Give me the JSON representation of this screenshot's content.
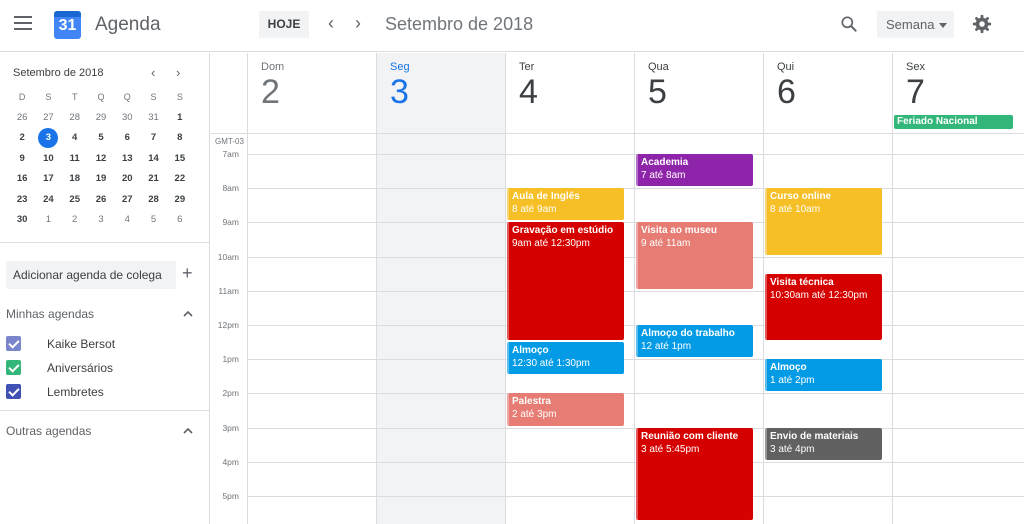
{
  "header": {
    "app_title": "Agenda",
    "logo_day": "31",
    "today_label": "HOJE",
    "month_title": "Setembro de 2018",
    "view_label": "Semana"
  },
  "colors": {
    "accent_blue": "#1a73e8",
    "holiday_green": "#33b679",
    "yellow": "#f6bf26",
    "red": "#d50000",
    "salmon": "#e67c73",
    "purple": "#8e24aa",
    "light_blue": "#039be5",
    "gray": "#616161"
  },
  "mini_calendar": {
    "title": "Setembro de 2018",
    "weekday_headers": [
      "D",
      "S",
      "T",
      "Q",
      "Q",
      "S",
      "S"
    ],
    "weeks": [
      [
        "26",
        "27",
        "28",
        "29",
        "30",
        "31",
        "1"
      ],
      [
        "2",
        "3",
        "4",
        "5",
        "6",
        "7",
        "8"
      ],
      [
        "9",
        "10",
        "11",
        "12",
        "13",
        "14",
        "15"
      ],
      [
        "16",
        "17",
        "18",
        "19",
        "20",
        "21",
        "22"
      ],
      [
        "23",
        "24",
        "25",
        "26",
        "27",
        "28",
        "29"
      ],
      [
        "30",
        "1",
        "2",
        "3",
        "4",
        "5",
        "6"
      ]
    ],
    "selected": "3"
  },
  "sidebar": {
    "add_calendar_placeholder": "Adicionar agenda de colega",
    "my_calendars_title": "Minhas agendas",
    "my_calendars": [
      {
        "label": "Kaike Bersot",
        "color": "#7986cb"
      },
      {
        "label": "Aniversários",
        "color": "#33b679"
      },
      {
        "label": "Lembretes",
        "color": "#3f51b5"
      }
    ],
    "other_calendars_title": "Outras agendas"
  },
  "week": {
    "timezone": "GMT-03",
    "days": [
      {
        "name": "Dom",
        "number": "2"
      },
      {
        "name": "Seg",
        "number": "3"
      },
      {
        "name": "Ter",
        "number": "4"
      },
      {
        "name": "Qua",
        "number": "5"
      },
      {
        "name": "Qui",
        "number": "6"
      },
      {
        "name": "Sex",
        "number": "7"
      }
    ],
    "hours": [
      "7am",
      "8am",
      "9am",
      "10am",
      "11am",
      "12pm",
      "1pm",
      "2pm",
      "3pm",
      "4pm",
      "5pm"
    ],
    "all_day": {
      "title": "Feriado Nacional",
      "day": 5
    }
  },
  "events": [
    {
      "title": "Academia",
      "time": "7 até 8am",
      "day": 3,
      "start": 7,
      "end": 8,
      "color": "#8e24aa"
    },
    {
      "title": "Aula de Inglês",
      "time": "8 até 9am",
      "day": 2,
      "start": 8,
      "end": 9,
      "color": "#f6bf26"
    },
    {
      "title": "Curso online",
      "time": "8 até 10am",
      "day": 4,
      "start": 8,
      "end": 10,
      "color": "#f6bf26"
    },
    {
      "title": "Gravação em estúdio",
      "time": "9am até 12:30pm",
      "day": 2,
      "start": 9,
      "end": 12.5,
      "color": "#d50000"
    },
    {
      "title": "Visita ao museu",
      "time": "9 até 11am",
      "day": 3,
      "start": 9,
      "end": 11,
      "color": "#e67c73"
    },
    {
      "title": "Visita técnica",
      "time": "10:30am até 12:30pm",
      "day": 4,
      "start": 10.5,
      "end": 12.5,
      "color": "#d50000"
    },
    {
      "title": "Almoço do trabalho",
      "time": "12 até 1pm",
      "day": 3,
      "start": 12,
      "end": 13,
      "color": "#039be5"
    },
    {
      "title": "Almoço",
      "time": "12:30 até 1:30pm",
      "day": 2,
      "start": 12.5,
      "end": 13.5,
      "color": "#039be5"
    },
    {
      "title": "Almoço",
      "time": "1 até 2pm",
      "day": 4,
      "start": 13,
      "end": 14,
      "color": "#039be5"
    },
    {
      "title": "Palestra",
      "time": "2 até 3pm",
      "day": 2,
      "start": 14,
      "end": 15,
      "color": "#e67c73"
    },
    {
      "title": "Reunião com cliente",
      "time": "3 até 5:45pm",
      "day": 3,
      "start": 15,
      "end": 17.75,
      "color": "#d50000"
    },
    {
      "title": "Envio de materiais",
      "time": "3 até 4pm",
      "day": 4,
      "start": 15,
      "end": 16,
      "color": "#616161"
    }
  ]
}
